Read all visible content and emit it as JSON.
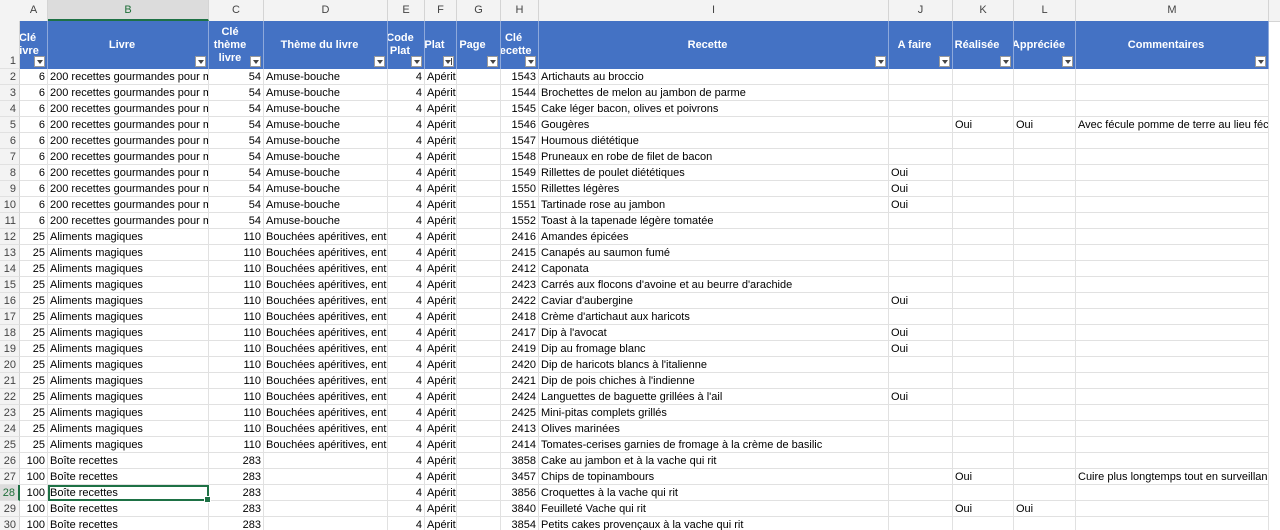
{
  "columns": [
    {
      "letter": "A",
      "header": "Clé livre",
      "sort": false
    },
    {
      "letter": "B",
      "header": "Livre",
      "sort": false
    },
    {
      "letter": "C",
      "header": "Clé thème livre",
      "sort": false
    },
    {
      "letter": "D",
      "header": "Thème du livre",
      "sort": false
    },
    {
      "letter": "E",
      "header": "Code Plat",
      "sort": false
    },
    {
      "letter": "F",
      "header": "Plat",
      "sort": true
    },
    {
      "letter": "G",
      "header": "Page",
      "sort": false
    },
    {
      "letter": "H",
      "header": "Clé recette",
      "sort": false
    },
    {
      "letter": "I",
      "header": "Recette",
      "sort": false
    },
    {
      "letter": "J",
      "header": "A faire",
      "sort": false
    },
    {
      "letter": "K",
      "header": "Réalisée",
      "sort": false
    },
    {
      "letter": "L",
      "header": "Appréciée",
      "sort": false
    },
    {
      "letter": "M",
      "header": "Commentaires",
      "sort": false
    }
  ],
  "selected": {
    "column": "B",
    "row": 28
  },
  "rows": [
    {
      "n": 2,
      "c": [
        "6",
        "200 recettes gourmandes pour m",
        "54",
        "Amuse-bouche",
        "4",
        "Apéritif",
        "",
        "1543",
        "Artichauts au broccio",
        "",
        "",
        "",
        ""
      ]
    },
    {
      "n": 3,
      "c": [
        "6",
        "200 recettes gourmandes pour m",
        "54",
        "Amuse-bouche",
        "4",
        "Apéritif",
        "",
        "1544",
        "Brochettes de melon au jambon de parme",
        "",
        "",
        "",
        ""
      ]
    },
    {
      "n": 4,
      "c": [
        "6",
        "200 recettes gourmandes pour m",
        "54",
        "Amuse-bouche",
        "4",
        "Apéritif",
        "",
        "1545",
        "Cake léger bacon, olives et poivrons",
        "",
        "",
        "",
        ""
      ]
    },
    {
      "n": 5,
      "c": [
        "6",
        "200 recettes gourmandes pour m",
        "54",
        "Amuse-bouche",
        "4",
        "Apéritif",
        "",
        "1546",
        "Gougères",
        "",
        "Oui",
        "Oui",
        "Avec fécule pomme de terre au lieu féc"
      ]
    },
    {
      "n": 6,
      "c": [
        "6",
        "200 recettes gourmandes pour m",
        "54",
        "Amuse-bouche",
        "4",
        "Apéritif",
        "",
        "1547",
        "Houmous diététique",
        "",
        "",
        "",
        ""
      ]
    },
    {
      "n": 7,
      "c": [
        "6",
        "200 recettes gourmandes pour m",
        "54",
        "Amuse-bouche",
        "4",
        "Apéritif",
        "",
        "1548",
        "Pruneaux en robe de filet de bacon",
        "",
        "",
        "",
        ""
      ]
    },
    {
      "n": 8,
      "c": [
        "6",
        "200 recettes gourmandes pour m",
        "54",
        "Amuse-bouche",
        "4",
        "Apéritif",
        "",
        "1549",
        "Rillettes de poulet diététiques",
        "Oui",
        "",
        "",
        ""
      ]
    },
    {
      "n": 9,
      "c": [
        "6",
        "200 recettes gourmandes pour m",
        "54",
        "Amuse-bouche",
        "4",
        "Apéritif",
        "",
        "1550",
        "Rillettes légères",
        "Oui",
        "",
        "",
        ""
      ]
    },
    {
      "n": 10,
      "c": [
        "6",
        "200 recettes gourmandes pour m",
        "54",
        "Amuse-bouche",
        "4",
        "Apéritif",
        "",
        "1551",
        "Tartinade rose au jambon",
        "Oui",
        "",
        "",
        ""
      ]
    },
    {
      "n": 11,
      "c": [
        "6",
        "200 recettes gourmandes pour m",
        "54",
        "Amuse-bouche",
        "4",
        "Apéritif",
        "",
        "1552",
        "Toast à la tapenade légère tomatée",
        "",
        "",
        "",
        ""
      ]
    },
    {
      "n": 12,
      "c": [
        "25",
        "Aliments magiques",
        "110",
        "Bouchées apéritives, ent",
        "4",
        "Apéritif",
        "",
        "2416",
        "Amandes épicées",
        "",
        "",
        "",
        ""
      ]
    },
    {
      "n": 13,
      "c": [
        "25",
        "Aliments magiques",
        "110",
        "Bouchées apéritives, ent",
        "4",
        "Apéritif",
        "",
        "2415",
        "Canapés au saumon fumé",
        "",
        "",
        "",
        ""
      ]
    },
    {
      "n": 14,
      "c": [
        "25",
        "Aliments magiques",
        "110",
        "Bouchées apéritives, ent",
        "4",
        "Apéritif",
        "",
        "2412",
        "Caponata",
        "",
        "",
        "",
        ""
      ]
    },
    {
      "n": 15,
      "c": [
        "25",
        "Aliments magiques",
        "110",
        "Bouchées apéritives, ent",
        "4",
        "Apéritif",
        "",
        "2423",
        "Carrés aux flocons d'avoine et au beurre d'arachide",
        "",
        "",
        "",
        ""
      ]
    },
    {
      "n": 16,
      "c": [
        "25",
        "Aliments magiques",
        "110",
        "Bouchées apéritives, ent",
        "4",
        "Apéritif",
        "",
        "2422",
        "Caviar d'aubergine",
        "Oui",
        "",
        "",
        ""
      ]
    },
    {
      "n": 17,
      "c": [
        "25",
        "Aliments magiques",
        "110",
        "Bouchées apéritives, ent",
        "4",
        "Apéritif",
        "",
        "2418",
        "Crème d'artichaut aux haricots",
        "",
        "",
        "",
        ""
      ]
    },
    {
      "n": 18,
      "c": [
        "25",
        "Aliments magiques",
        "110",
        "Bouchées apéritives, ent",
        "4",
        "Apéritif",
        "",
        "2417",
        "Dip à l'avocat",
        "Oui",
        "",
        "",
        ""
      ]
    },
    {
      "n": 19,
      "c": [
        "25",
        "Aliments magiques",
        "110",
        "Bouchées apéritives, ent",
        "4",
        "Apéritif",
        "",
        "2419",
        "Dip au fromage blanc",
        "Oui",
        "",
        "",
        ""
      ]
    },
    {
      "n": 20,
      "c": [
        "25",
        "Aliments magiques",
        "110",
        "Bouchées apéritives, ent",
        "4",
        "Apéritif",
        "",
        "2420",
        "Dip de haricots blancs à l'italienne",
        "",
        "",
        "",
        ""
      ]
    },
    {
      "n": 21,
      "c": [
        "25",
        "Aliments magiques",
        "110",
        "Bouchées apéritives, ent",
        "4",
        "Apéritif",
        "",
        "2421",
        "Dip de pois chiches à l'indienne",
        "",
        "",
        "",
        ""
      ]
    },
    {
      "n": 22,
      "c": [
        "25",
        "Aliments magiques",
        "110",
        "Bouchées apéritives, ent",
        "4",
        "Apéritif",
        "",
        "2424",
        "Languettes de baguette grillées à l'ail",
        "Oui",
        "",
        "",
        ""
      ]
    },
    {
      "n": 23,
      "c": [
        "25",
        "Aliments magiques",
        "110",
        "Bouchées apéritives, ent",
        "4",
        "Apéritif",
        "",
        "2425",
        "Mini-pitas complets grillés",
        "",
        "",
        "",
        ""
      ]
    },
    {
      "n": 24,
      "c": [
        "25",
        "Aliments magiques",
        "110",
        "Bouchées apéritives, ent",
        "4",
        "Apéritif",
        "",
        "2413",
        "Olives marinées",
        "",
        "",
        "",
        ""
      ]
    },
    {
      "n": 25,
      "c": [
        "25",
        "Aliments magiques",
        "110",
        "Bouchées apéritives, ent",
        "4",
        "Apéritif",
        "",
        "2414",
        "Tomates-cerises garnies de fromage à la crème de basilic",
        "",
        "",
        "",
        ""
      ]
    },
    {
      "n": 26,
      "c": [
        "100",
        "Boîte recettes",
        "283",
        "",
        "4",
        "Apéritif",
        "",
        "3858",
        "Cake au jambon et à la vache qui rit",
        "",
        "",
        "",
        ""
      ]
    },
    {
      "n": 27,
      "c": [
        "100",
        "Boîte recettes",
        "283",
        "",
        "4",
        "Apéritif",
        "",
        "3457",
        "Chips de topinambours",
        "",
        "Oui",
        "",
        "Cuire plus longtemps tout en surveillan"
      ]
    },
    {
      "n": 28,
      "c": [
        "100",
        "Boîte recettes",
        "283",
        "",
        "4",
        "Apéritif",
        "",
        "3856",
        "Croquettes à la vache qui rit",
        "",
        "",
        "",
        ""
      ]
    },
    {
      "n": 29,
      "c": [
        "100",
        "Boîte recettes",
        "283",
        "",
        "4",
        "Apéritif",
        "",
        "3840",
        "Feuilleté Vache qui rit",
        "",
        "Oui",
        "Oui",
        ""
      ]
    },
    {
      "n": 30,
      "c": [
        "100",
        "Boîte recettes",
        "283",
        "",
        "4",
        "Apéritif",
        "",
        "3854",
        "Petits cakes provençaux à la vache qui rit",
        "",
        "",
        "",
        ""
      ]
    }
  ]
}
